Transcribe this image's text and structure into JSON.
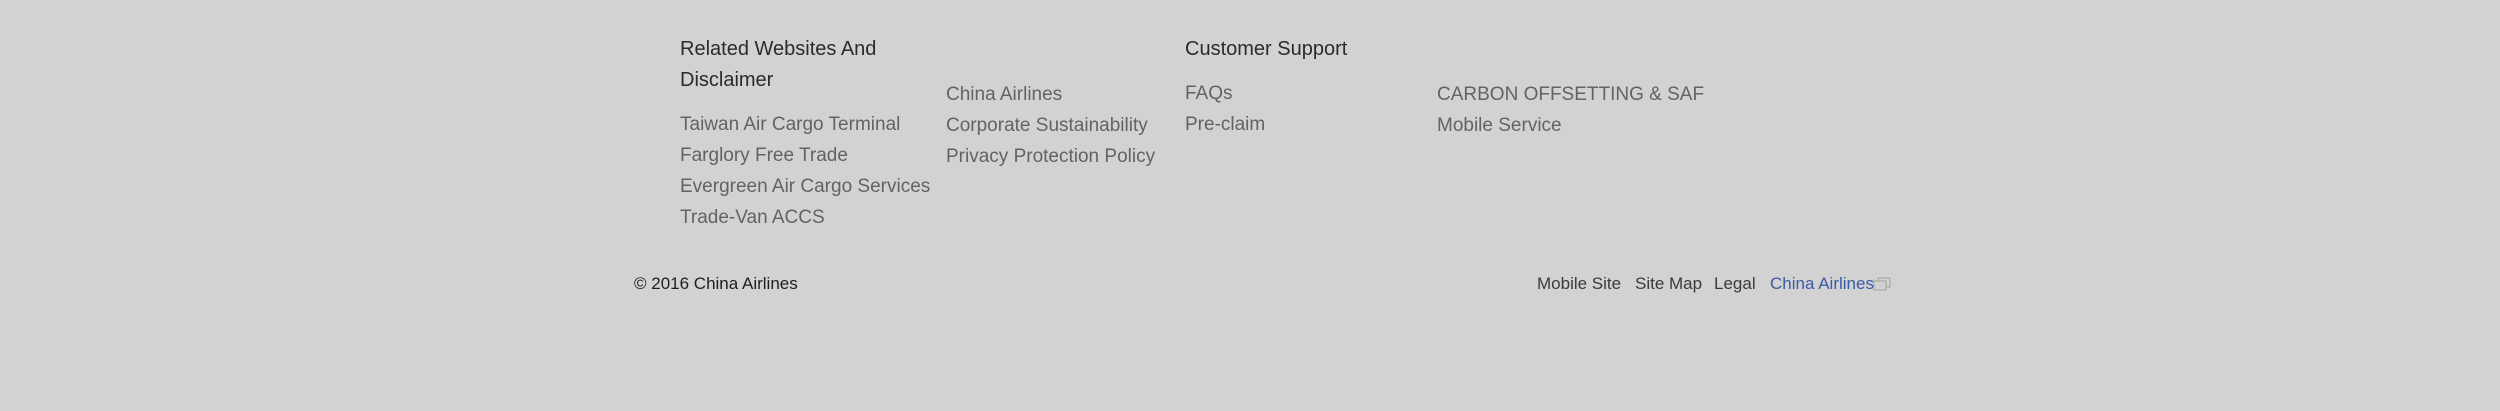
{
  "columns": {
    "related": {
      "heading_line1": "Related Websites And",
      "heading_line2": "Disclaimer",
      "links": [
        "Taiwan Air Cargo Terminal",
        "Farglory Free Trade",
        "Evergreen Air Cargo Services",
        "Trade-Van ACCS"
      ]
    },
    "company": {
      "links": [
        "China Airlines",
        "Corporate Sustainability",
        "Privacy Protection Policy"
      ]
    },
    "support": {
      "heading": "Customer Support",
      "links": [
        "FAQs",
        "Pre-claim"
      ]
    },
    "other": {
      "links": [
        "CARBON OFFSETTING & SAF",
        "Mobile Service"
      ]
    }
  },
  "bottom_bar": {
    "copyright": "© 2016 China Airlines",
    "links": [
      "Mobile Site",
      "Site Map",
      "Legal",
      "China Airlines"
    ],
    "external_icon": "external-window-icon"
  },
  "colors": {
    "background": "#d2d2d2",
    "heading": "#2b2b2b",
    "link": "#636363",
    "brand_link": "#3d5aa8"
  }
}
